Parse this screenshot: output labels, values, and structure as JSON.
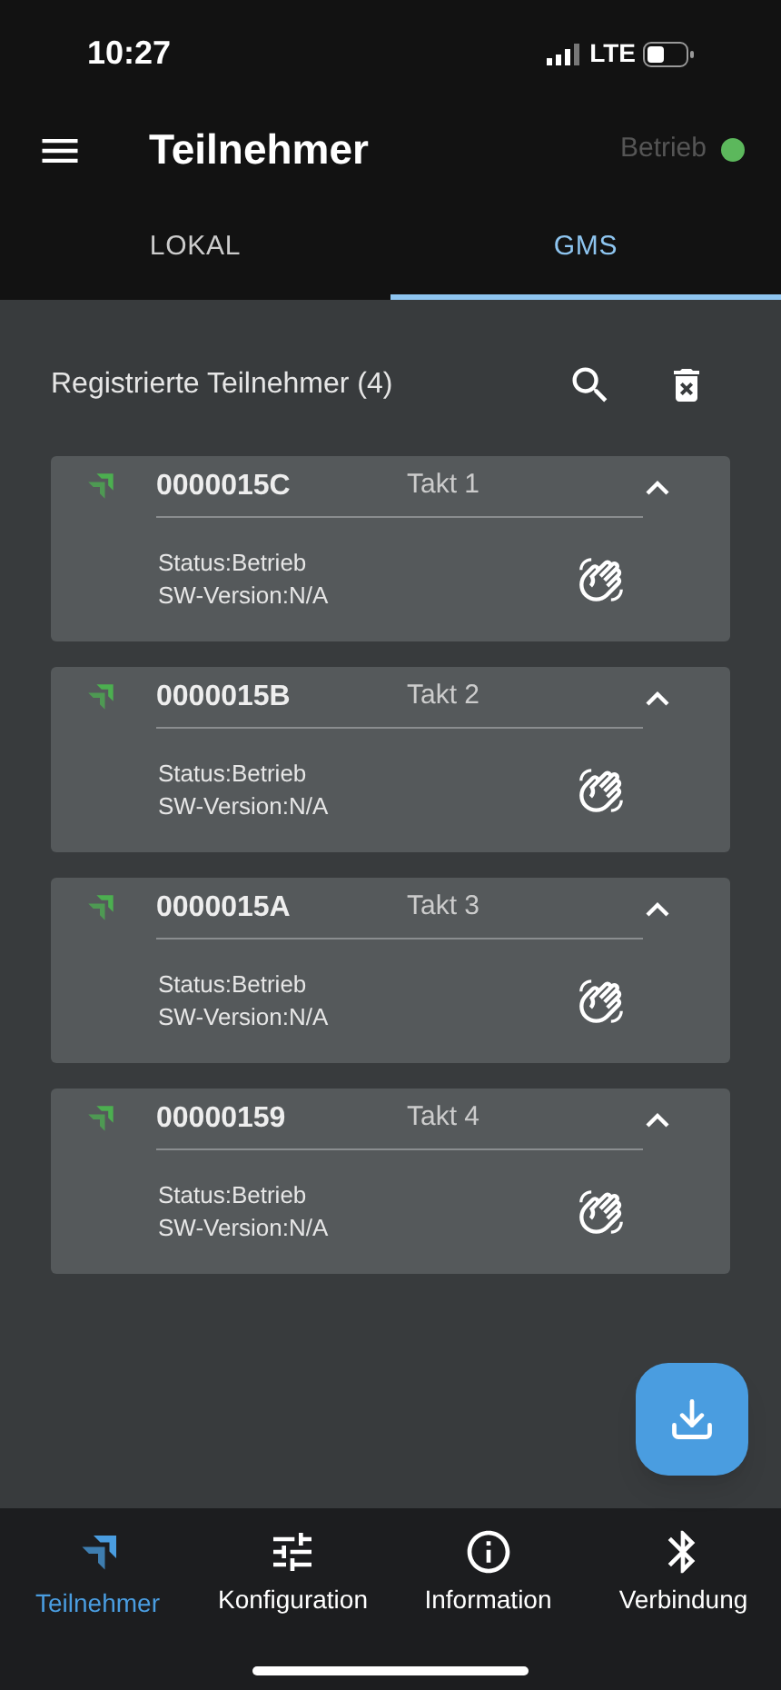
{
  "status_bar": {
    "time": "10:27",
    "network": "LTE"
  },
  "app_bar": {
    "title": "Teilnehmer",
    "status": {
      "label": "Betrieb",
      "color": "#5cb85c"
    }
  },
  "tabs": [
    {
      "label": "LOKAL",
      "selected": false
    },
    {
      "label": "GMS",
      "selected": true
    }
  ],
  "section": {
    "title": "Registrierte Teilnehmer (4)"
  },
  "participants": [
    {
      "id": "0000015C",
      "takt": "Takt 1",
      "status": "Status:Betrieb",
      "version": "SW-Version:N/A",
      "expanded": true
    },
    {
      "id": "0000015B",
      "takt": "Takt 2",
      "status": "Status:Betrieb",
      "version": "SW-Version:N/A",
      "expanded": true
    },
    {
      "id": "0000015A",
      "takt": "Takt 3",
      "status": "Status:Betrieb",
      "version": "SW-Version:N/A",
      "expanded": true
    },
    {
      "id": "00000159",
      "takt": "Takt 4",
      "status": "Status:Betrieb",
      "version": "SW-Version:N/A",
      "expanded": true
    }
  ],
  "bottom_nav": [
    {
      "label": "Teilnehmer",
      "kind": "participants",
      "selected": true
    },
    {
      "label": "Konfiguration",
      "kind": "config",
      "selected": false
    },
    {
      "label": "Information",
      "kind": "info",
      "selected": false
    },
    {
      "label": "Verbindung",
      "kind": "bluetooth",
      "selected": false
    }
  ]
}
